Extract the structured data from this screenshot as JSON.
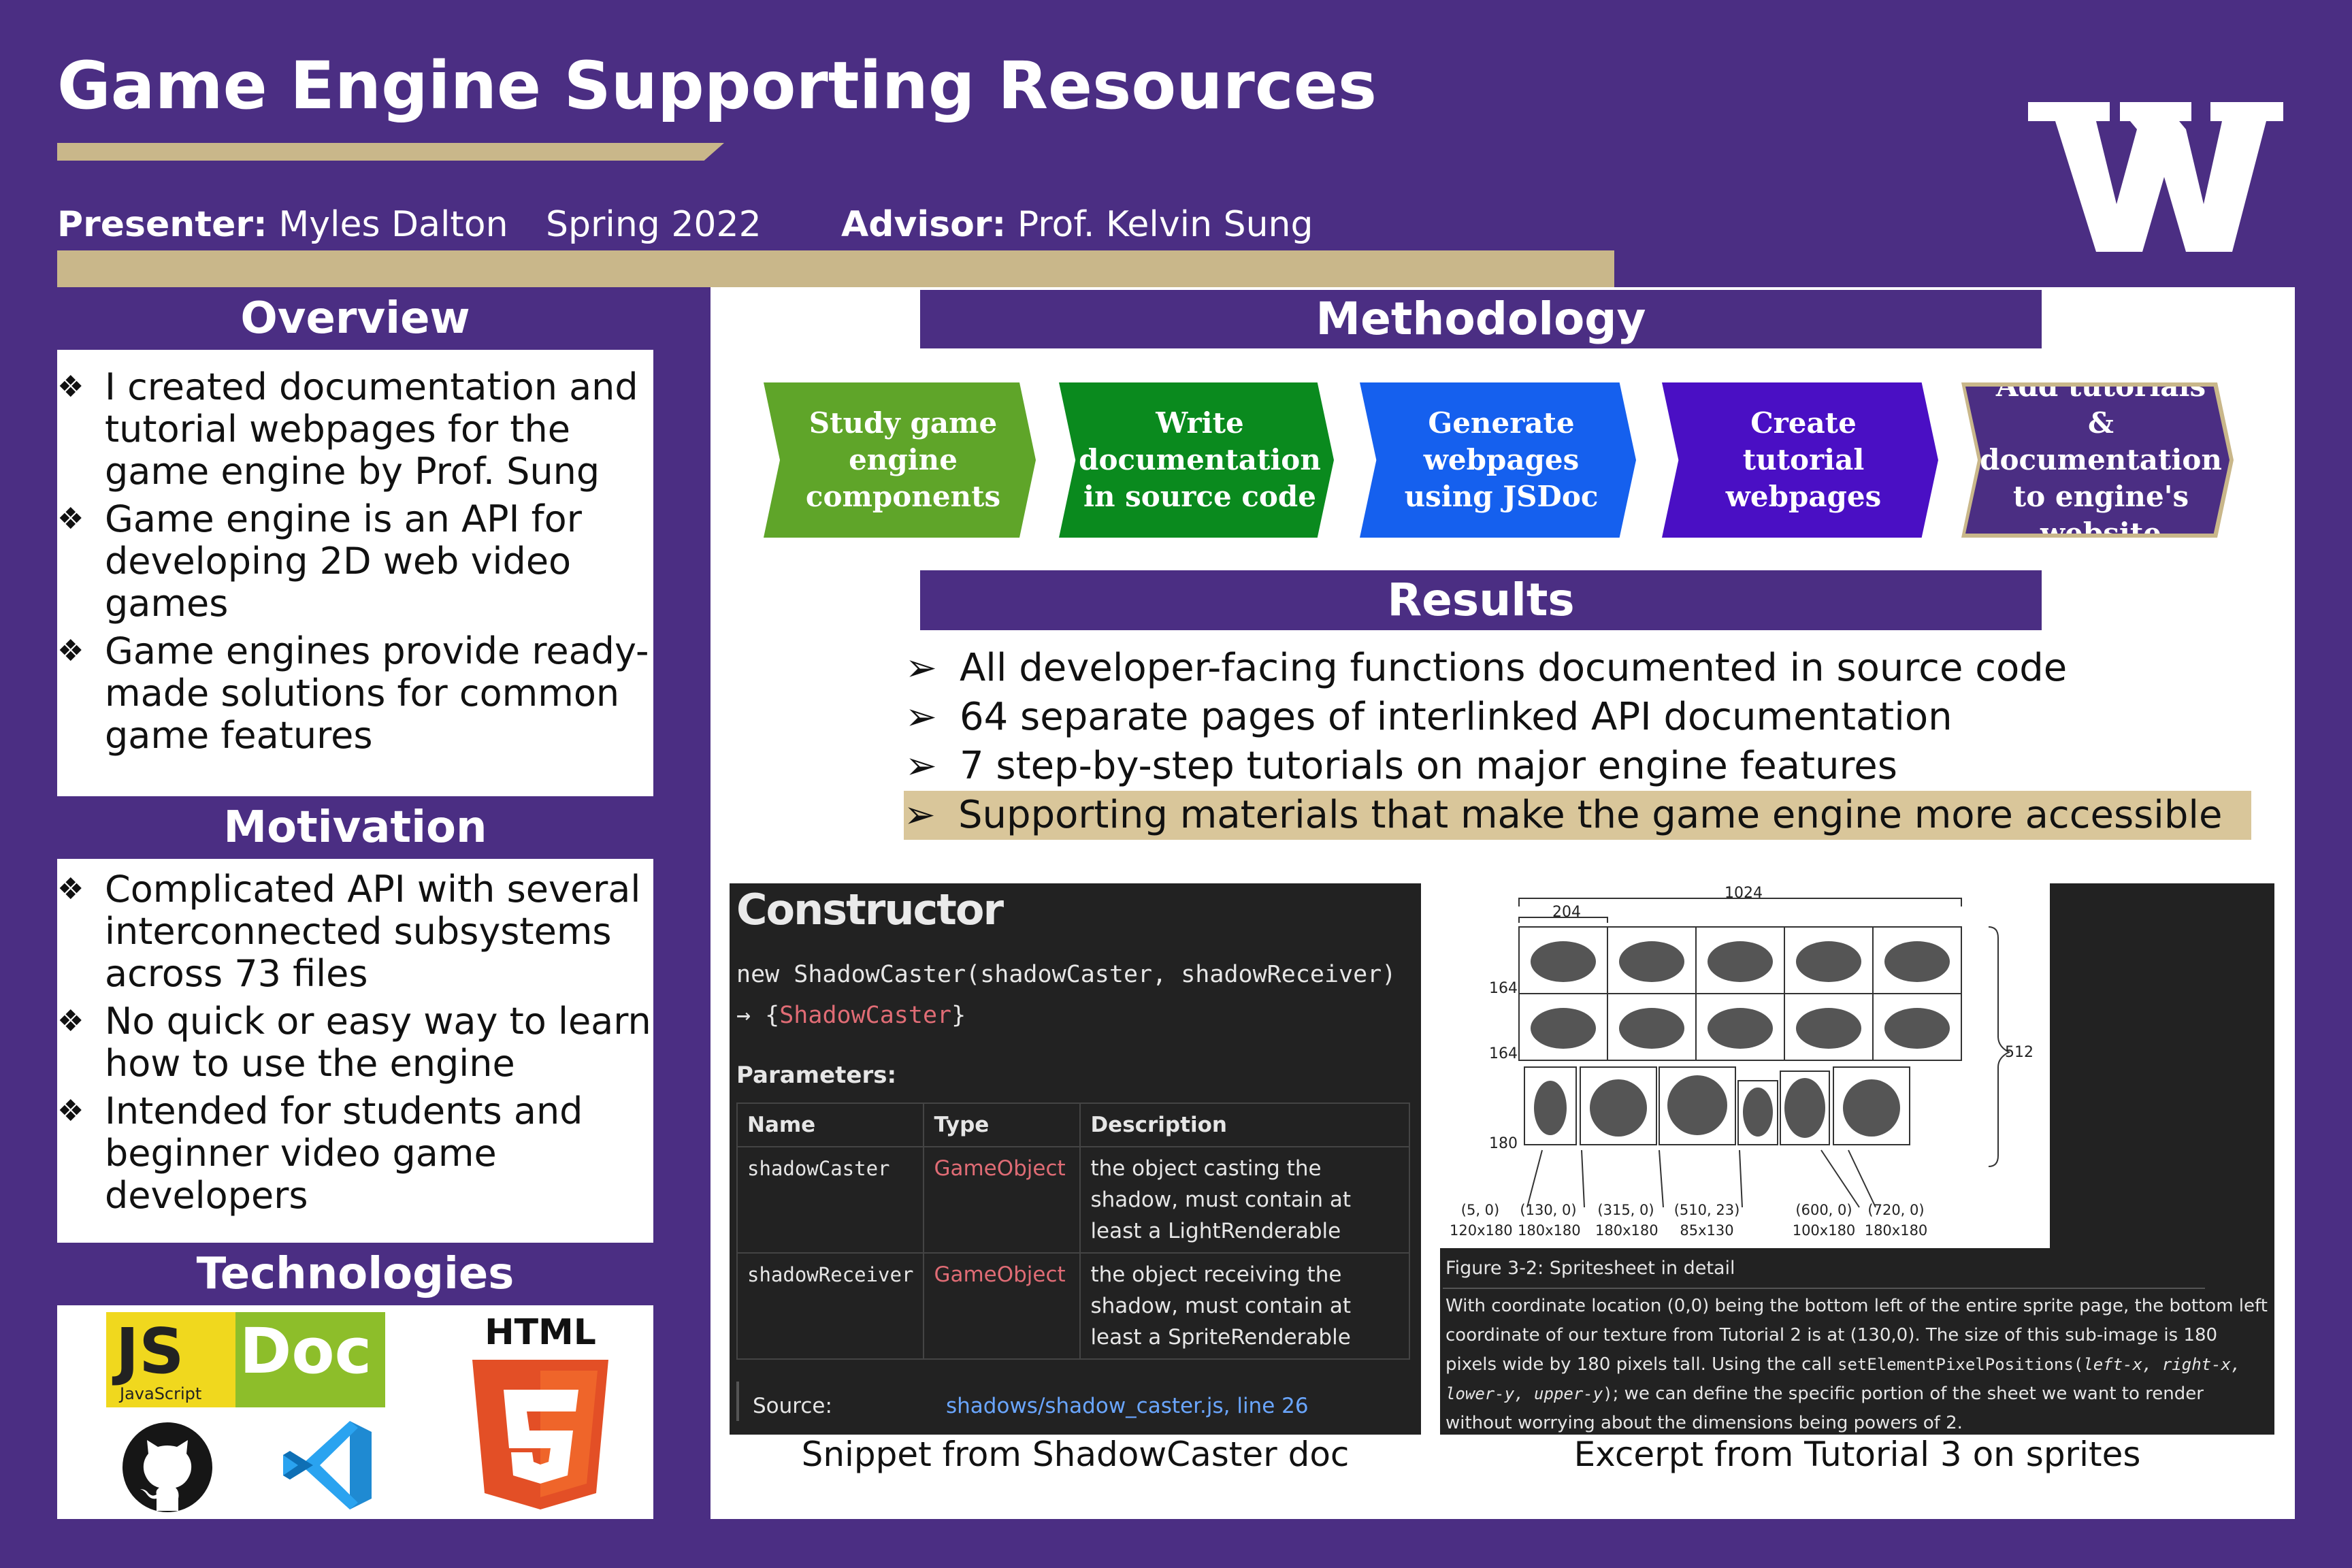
{
  "title": "Game Engine Supporting Resources",
  "presenter": {
    "label": "Presenter:",
    "name": "Myles Dalton"
  },
  "term": "Spring 2022",
  "advisor": {
    "label": "Advisor:",
    "name": "Prof. Kelvin Sung"
  },
  "logo": {
    "letter": "W",
    "icon": "uw-w-logo"
  },
  "colors": {
    "purple": "#4b2e83",
    "gold": "#c9b78a"
  },
  "overview": {
    "heading": "Overview",
    "items": [
      "I created documentation and tutorial webpages for the game engine by Prof. Sung",
      "Game engine is an API for developing 2D web video games",
      "Game engines provide ready-made solutions for common game features"
    ]
  },
  "motivation": {
    "heading": "Motivation",
    "items": [
      "Complicated API  with several interconnected subsystems across 73 files",
      "No quick or easy way to learn how to use the engine",
      "Intended for students and beginner video game developers"
    ]
  },
  "technologies": {
    "heading": "Technologies",
    "jsdoc": {
      "js": "JS",
      "doc": "Doc",
      "sub": "JavaScript"
    },
    "html5": {
      "label": "HTML",
      "number": "5"
    },
    "icons": [
      "jsdoc-logo-icon",
      "html5-logo-icon",
      "github-logo-icon",
      "vscode-logo-icon"
    ]
  },
  "methodology": {
    "heading": "Methodology",
    "steps": [
      {
        "label": "Study game engine components",
        "color": "#5fa529"
      },
      {
        "label": "Write documentation in source code",
        "color": "#0a8a1e"
      },
      {
        "label": "Generate webpages using JSDoc",
        "color": "#1560ee"
      },
      {
        "label": "Create tutorial webpages",
        "color": "#4a0fc4"
      },
      {
        "label": "Add tutorials & documentation to engine's website",
        "color": "#4b2e83"
      }
    ]
  },
  "results": {
    "heading": "Results",
    "items": [
      "All developer-facing functions documented in source code",
      "64 separate pages of interlinked API documentation",
      "7 step-by-step tutorials on major engine features",
      "Supporting materials that make the game engine more accessible"
    ]
  },
  "doc_snippet": {
    "heading": "Constructor",
    "signature": "new ShadowCaster(shadowCaster, shadowReceiver)",
    "returns_arrow": "→",
    "returns_open": "{",
    "returns_type": "ShadowCaster",
    "returns_close": "}",
    "params_heading": "Parameters:",
    "columns": [
      "Name",
      "Type",
      "Description"
    ],
    "rows": [
      {
        "name": "shadowCaster",
        "type": "GameObject",
        "description": "the object casting the shadow, must contain at least a LightRenderable"
      },
      {
        "name": "shadowReceiver",
        "type": "GameObject",
        "description": "the object receiving the shadow, must contain at least a SpriteRenderable"
      }
    ],
    "source_label": "Source:",
    "source_link": "shadows/shadow_caster.js, line 26",
    "caption": "Snippet from ShadowCaster doc"
  },
  "tutorial_excerpt": {
    "dims": {
      "width": "1024",
      "cell_width": "204",
      "height": "512",
      "row1": "164",
      "row2": "164",
      "row3": "180"
    },
    "coords": [
      "(5, 0)",
      "(130, 0)",
      "(315, 0)",
      "(510, 23)",
      "(600, 0)",
      "(720, 0)"
    ],
    "sizes": [
      "120x180",
      "180x180",
      "180x180",
      "85x130",
      "100x180",
      "180x180"
    ],
    "figure_caption": "Figure 3-2: Spritesheet in detail",
    "text_before": "With coordinate location (0,0) being the bottom left of the entire sprite page, the bottom left coordinate of our texture from Tutorial 2 is at (130,0). The size of this sub-image is 180 pixels wide by 180 pixels tall. Using the call ",
    "code": "setElementPixelPositions(",
    "code_args": "left-x, right-x, lower-y, upper-y",
    "code_close": ")",
    "text_after": "; we can define the specific portion of the sheet we want to render without worrying about the dimensions being powers of 2.",
    "caption": "Excerpt from Tutorial 3 on sprites"
  }
}
